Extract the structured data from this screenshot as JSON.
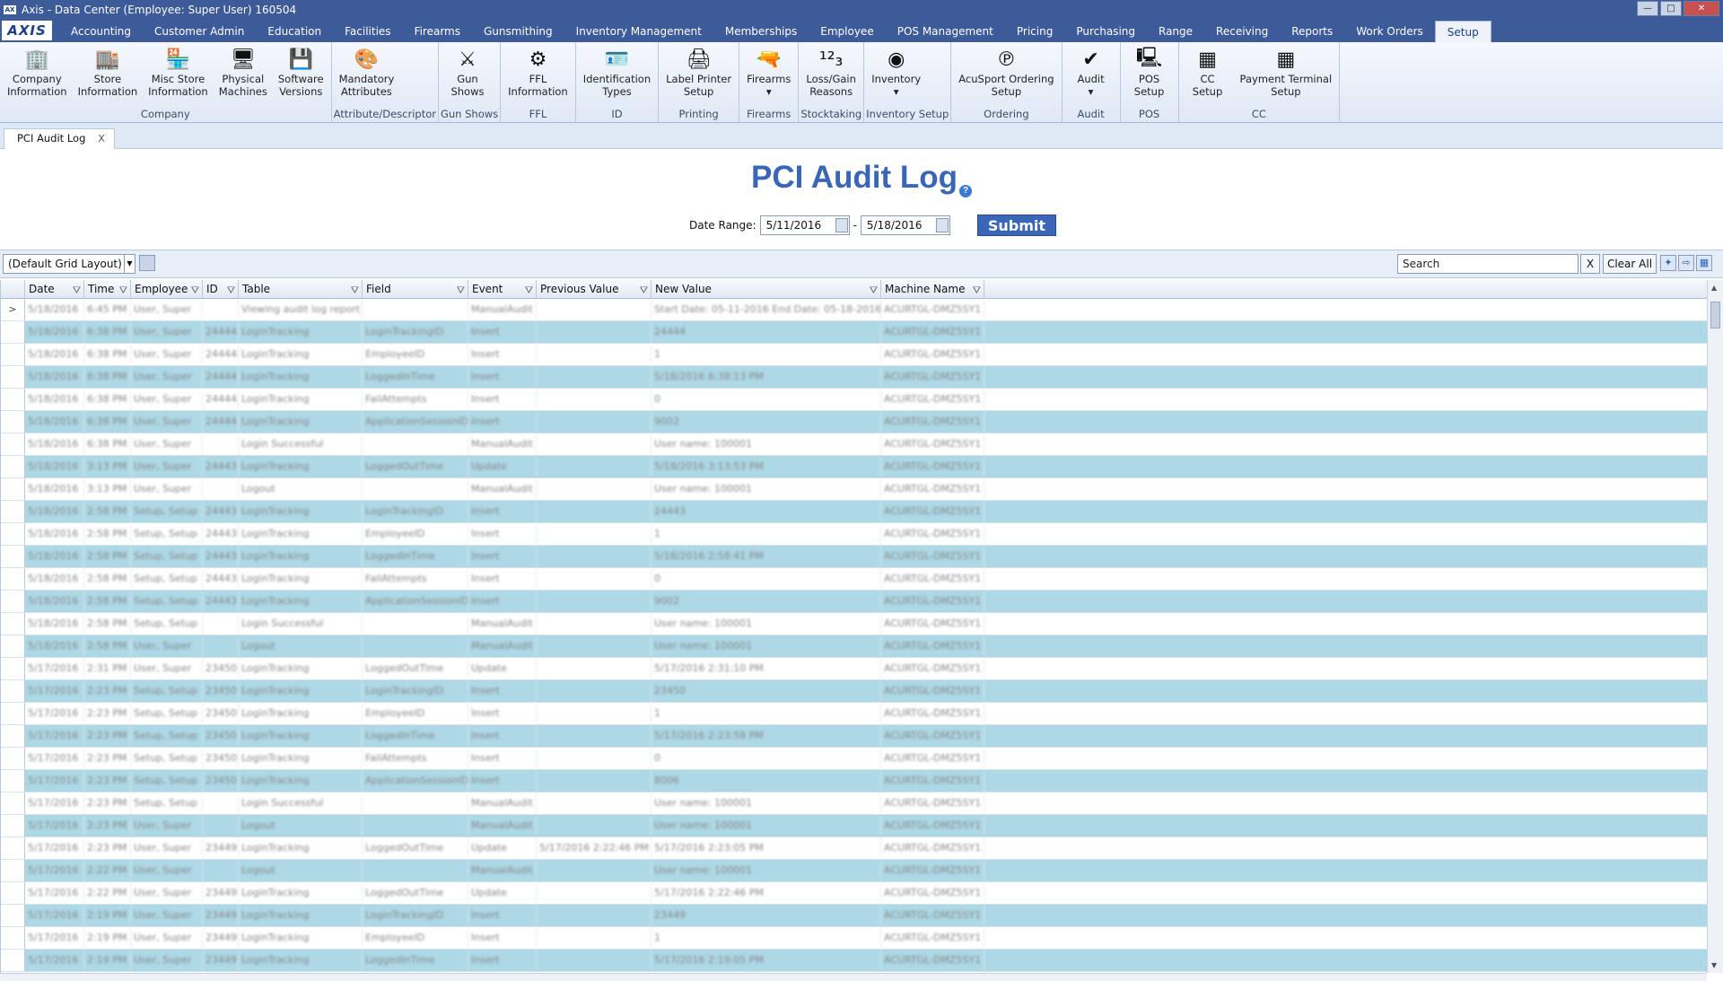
{
  "window": {
    "title": "Axis - Data Center  (Employee: Super User) 160504",
    "app_icon": "axis-app-icon"
  },
  "logo": "AXIS",
  "menu": [
    "Accounting",
    "Customer Admin",
    "Education",
    "Facilities",
    "Firearms",
    "Gunsmithing",
    "Inventory Management",
    "Memberships",
    "Employee",
    "POS Management",
    "Pricing",
    "Purchasing",
    "Range",
    "Receiving",
    "Reports",
    "Work Orders",
    "Setup"
  ],
  "active_menu": "Setup",
  "ribbon": {
    "groups": [
      {
        "label": "Company",
        "buttons": [
          "Company\nInformation",
          "Store\nInformation",
          "Misc Store\nInformation",
          "Physical\nMachines",
          "Software\nVersions"
        ]
      },
      {
        "label": "Attribute/Descriptor",
        "buttons": [
          "Mandatory\nAttributes"
        ]
      },
      {
        "label": "Gun Shows",
        "buttons": [
          "Gun\nShows"
        ]
      },
      {
        "label": "FFL",
        "buttons": [
          "FFL\nInformation"
        ]
      },
      {
        "label": "ID",
        "buttons": [
          "Identification\nTypes"
        ]
      },
      {
        "label": "Printing",
        "buttons": [
          "Label Printer\nSetup"
        ]
      },
      {
        "label": "Firearms",
        "buttons": [
          "Firearms\n▾"
        ]
      },
      {
        "label": "Stocktaking",
        "buttons": [
          "Loss/Gain\nReasons"
        ]
      },
      {
        "label": "Inventory Setup",
        "buttons": [
          "Inventory\n▾"
        ]
      },
      {
        "label": "Ordering",
        "buttons": [
          "AcuSport Ordering\nSetup"
        ]
      },
      {
        "label": "Audit",
        "buttons": [
          "Audit\n▾"
        ]
      },
      {
        "label": "POS",
        "buttons": [
          "POS\nSetup"
        ]
      },
      {
        "label": "CC",
        "buttons": [
          "CC\nSetup",
          "Payment Terminal\nSetup"
        ]
      }
    ]
  },
  "doc_tab": {
    "label": "PCI Audit Log",
    "close": "X"
  },
  "page": {
    "title": "PCI Audit Log",
    "help": "?"
  },
  "date_range": {
    "label": "Date Range:",
    "from": "5/11/2016",
    "separator": "-",
    "to": "5/18/2016",
    "submit": "Submit"
  },
  "grid_toolbar": {
    "layout": "(Default Grid Layout)",
    "search_placeholder": "Search",
    "clear_x": "X",
    "clear_all": "Clear All"
  },
  "columns": [
    "Date",
    "Time",
    "Employee",
    "ID",
    "Table",
    "Field",
    "Event",
    "Previous Value",
    "New Value",
    "Machine Name"
  ],
  "current_row_marker": ">",
  "rows": [
    [
      "5/18/2016",
      "6:45 PM",
      "User, Super",
      "",
      "Viewing audit log report",
      "",
      "ManualAudit",
      "",
      "Start Date: 05-11-2016  End Date: 05-18-2016",
      "ACURTGL-DMZ5SY1"
    ],
    [
      "5/18/2016",
      "6:38 PM",
      "User, Super",
      "24444",
      "LoginTracking",
      "LoginTrackingID",
      "Insert",
      "",
      "24444",
      "ACURTGL-DMZ5SY1"
    ],
    [
      "5/18/2016",
      "6:38 PM",
      "User, Super",
      "24444",
      "LoginTracking",
      "EmployeeID",
      "Insert",
      "",
      "1",
      "ACURTGL-DMZ5SY1"
    ],
    [
      "5/18/2016",
      "6:38 PM",
      "User, Super",
      "24444",
      "LoginTracking",
      "LoggedInTime",
      "Insert",
      "",
      "5/18/2016 6:38:13 PM",
      "ACURTGL-DMZ5SY1"
    ],
    [
      "5/18/2016",
      "6:38 PM",
      "User, Super",
      "24444",
      "LoginTracking",
      "FailAttempts",
      "Insert",
      "",
      "0",
      "ACURTGL-DMZ5SY1"
    ],
    [
      "5/18/2016",
      "6:38 PM",
      "User, Super",
      "24444",
      "LoginTracking",
      "ApplicationSessionID",
      "Insert",
      "",
      "9002",
      "ACURTGL-DMZ5SY1"
    ],
    [
      "5/18/2016",
      "6:38 PM",
      "User, Super",
      "",
      "Login Successful",
      "",
      "ManualAudit",
      "",
      "User name: 100001",
      "ACURTGL-DMZ5SY1"
    ],
    [
      "5/18/2016",
      "3:13 PM",
      "User, Super",
      "24443",
      "LoginTracking",
      "LoggedOutTime",
      "Update",
      "",
      "5/18/2016 3:13:53 PM",
      "ACURTGL-DMZ5SY1"
    ],
    [
      "5/18/2016",
      "3:13 PM",
      "User, Super",
      "",
      "Logout",
      "",
      "ManualAudit",
      "",
      "User name: 100001",
      "ACURTGL-DMZ5SY1"
    ],
    [
      "5/18/2016",
      "2:58 PM",
      "Setup, Setup",
      "24443",
      "LoginTracking",
      "LoginTrackingID",
      "Insert",
      "",
      "24443",
      "ACURTGL-DMZ5SY1"
    ],
    [
      "5/18/2016",
      "2:58 PM",
      "Setup, Setup",
      "24443",
      "LoginTracking",
      "EmployeeID",
      "Insert",
      "",
      "1",
      "ACURTGL-DMZ5SY1"
    ],
    [
      "5/18/2016",
      "2:58 PM",
      "Setup, Setup",
      "24443",
      "LoginTracking",
      "LoggedInTime",
      "Insert",
      "",
      "5/18/2016 2:58:41 PM",
      "ACURTGL-DMZ5SY1"
    ],
    [
      "5/18/2016",
      "2:58 PM",
      "Setup, Setup",
      "24443",
      "LoginTracking",
      "FailAttempts",
      "Insert",
      "",
      "0",
      "ACURTGL-DMZ5SY1"
    ],
    [
      "5/18/2016",
      "2:58 PM",
      "Setup, Setup",
      "24443",
      "LoginTracking",
      "ApplicationSessionID",
      "Insert",
      "",
      "9002",
      "ACURTGL-DMZ5SY1"
    ],
    [
      "5/18/2016",
      "2:58 PM",
      "Setup, Setup",
      "",
      "Login Successful",
      "",
      "ManualAudit",
      "",
      "User name: 100001",
      "ACURTGL-DMZ5SY1"
    ],
    [
      "5/18/2016",
      "2:58 PM",
      "User, Super",
      "",
      "Logout",
      "",
      "ManualAudit",
      "",
      "User name: 100001",
      "ACURTGL-DMZ5SY1"
    ],
    [
      "5/17/2016",
      "2:31 PM",
      "User, Super",
      "23450",
      "LoginTracking",
      "LoggedOutTime",
      "Update",
      "",
      "5/17/2016 2:31:10 PM",
      "ACURTGL-DMZ5SY1"
    ],
    [
      "5/17/2016",
      "2:23 PM",
      "Setup, Setup",
      "23450",
      "LoginTracking",
      "LoginTrackingID",
      "Insert",
      "",
      "23450",
      "ACURTGL-DMZ5SY1"
    ],
    [
      "5/17/2016",
      "2:23 PM",
      "Setup, Setup",
      "23450",
      "LoginTracking",
      "EmployeeID",
      "Insert",
      "",
      "1",
      "ACURTGL-DMZ5SY1"
    ],
    [
      "5/17/2016",
      "2:23 PM",
      "Setup, Setup",
      "23450",
      "LoginTracking",
      "LoggedInTime",
      "Insert",
      "",
      "5/17/2016 2:23:58 PM",
      "ACURTGL-DMZ5SY1"
    ],
    [
      "5/17/2016",
      "2:23 PM",
      "Setup, Setup",
      "23450",
      "LoginTracking",
      "FailAttempts",
      "Insert",
      "",
      "0",
      "ACURTGL-DMZ5SY1"
    ],
    [
      "5/17/2016",
      "2:23 PM",
      "Setup, Setup",
      "23450",
      "LoginTracking",
      "ApplicationSessionID",
      "Insert",
      "",
      "8006",
      "ACURTGL-DMZ5SY1"
    ],
    [
      "5/17/2016",
      "2:23 PM",
      "Setup, Setup",
      "",
      "Login Successful",
      "",
      "ManualAudit",
      "",
      "User name: 100001",
      "ACURTGL-DMZ5SY1"
    ],
    [
      "5/17/2016",
      "2:23 PM",
      "User, Super",
      "",
      "Logout",
      "",
      "ManualAudit",
      "",
      "User name: 100001",
      "ACURTGL-DMZ5SY1"
    ],
    [
      "5/17/2016",
      "2:23 PM",
      "User, Super",
      "23449",
      "LoginTracking",
      "LoggedOutTime",
      "Update",
      "5/17/2016 2:22:46 PM",
      "5/17/2016 2:23:05 PM",
      "ACURTGL-DMZ5SY1"
    ],
    [
      "5/17/2016",
      "2:22 PM",
      "User, Super",
      "",
      "Logout",
      "",
      "ManualAudit",
      "",
      "User name: 100001",
      "ACURTGL-DMZ5SY1"
    ],
    [
      "5/17/2016",
      "2:22 PM",
      "User, Super",
      "23449",
      "LoginTracking",
      "LoggedOutTime",
      "Update",
      "",
      "5/17/2016 2:22:46 PM",
      "ACURTGL-DMZ5SY1"
    ],
    [
      "5/17/2016",
      "2:19 PM",
      "User, Super",
      "23449",
      "LoginTracking",
      "LoginTrackingID",
      "Insert",
      "",
      "23449",
      "ACURTGL-DMZ5SY1"
    ],
    [
      "5/17/2016",
      "2:19 PM",
      "User, Super",
      "23449",
      "LoginTracking",
      "EmployeeID",
      "Insert",
      "",
      "1",
      "ACURTGL-DMZ5SY1"
    ],
    [
      "5/17/2016",
      "2:19 PM",
      "User, Super",
      "23449",
      "LoginTracking",
      "LoggedInTime",
      "Insert",
      "",
      "5/17/2016 2:19:05 PM",
      "ACURTGL-DMZ5SY1"
    ]
  ]
}
